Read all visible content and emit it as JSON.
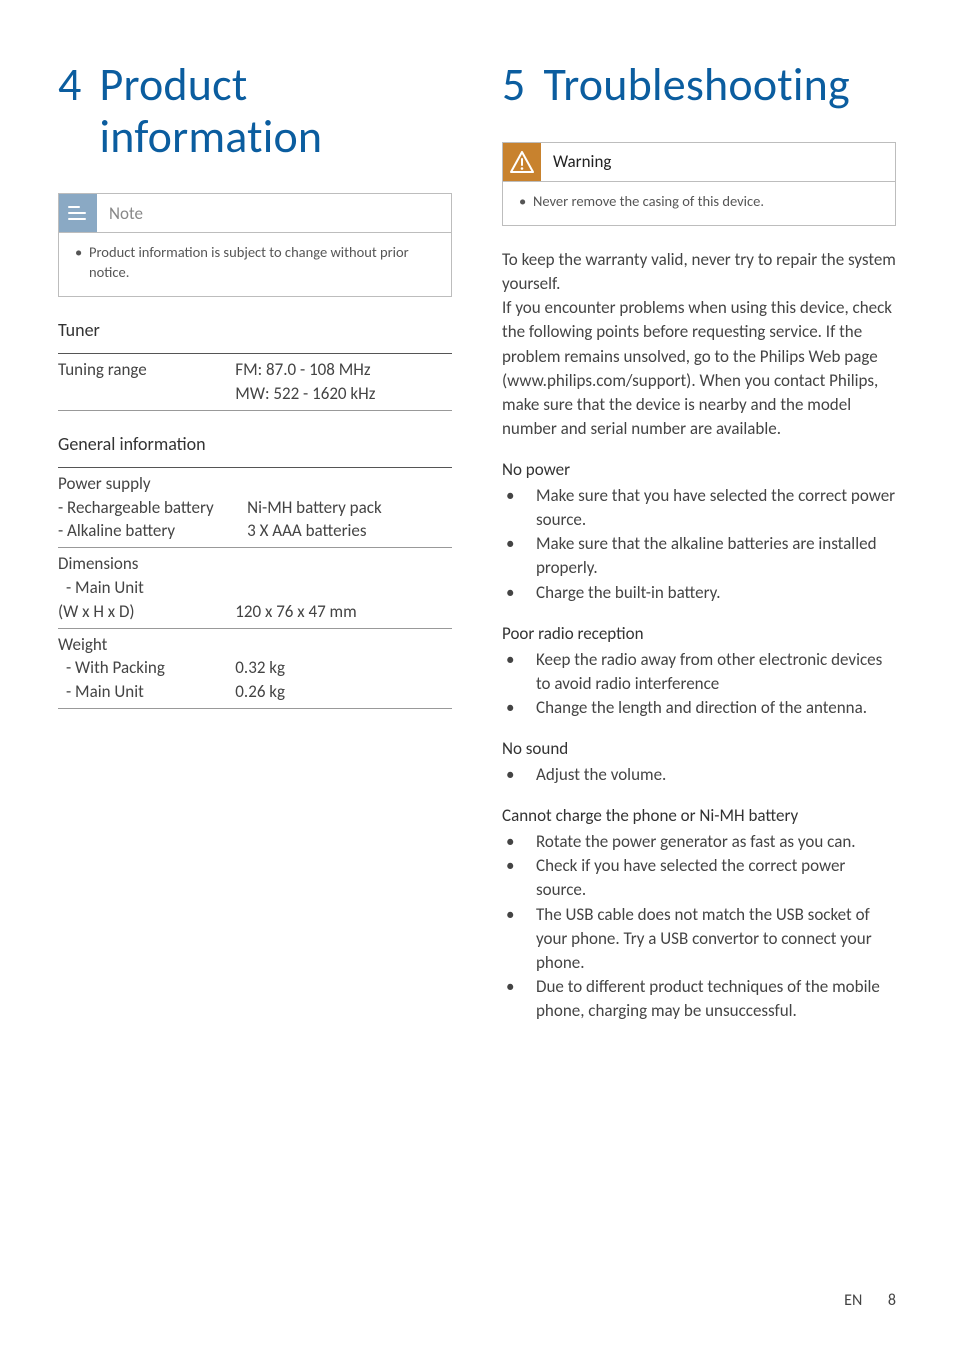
{
  "left": {
    "number": "4",
    "title": "Product information",
    "note_label": "Note",
    "note_text": "Product information is subject to change without prior notice.",
    "tuner_heading": "Tuner",
    "tuner": {
      "label": "Tuning range",
      "fm": "FM: 87.0 - 108 MHz",
      "mw": "MW: 522 - 1620 kHz"
    },
    "general_heading": "General information",
    "power": {
      "label": "Power supply",
      "r_label": " - Rechargeable battery",
      "r_value": "Ni-MH battery pack",
      "a_label": " - Alkaline battery",
      "a_value": "3 X AAA batteries"
    },
    "dim": {
      "label": "Dimensions",
      "sub_label": " - Main Unit",
      "sub_unit": "(W x H x D)",
      "value": "120 x 76 x 47 mm"
    },
    "weight": {
      "label": "Weight",
      "pack_label": " - With Packing",
      "pack_value": "0.32 kg",
      "main_label": " - Main Unit",
      "main_value": "0.26 kg"
    }
  },
  "right": {
    "number": "5",
    "title": "Troubleshooting",
    "warn_label": "Warning",
    "warn_text": "Never remove the casing of this device.",
    "intro": "To keep the warranty valid, never try to repair the system yourself.\nIf you encounter problems when using this device, check the following points before requesting service. If the problem remains unsolved, go to the Philips Web page (www.philips.com/support). When you contact Philips, make sure that the device is nearby and the model number and serial number are available.",
    "issues": [
      {
        "heading": "No power",
        "items": [
          "Make sure that you have selected the correct power source.",
          "Make sure that the alkaline batteries are installed properly.",
          "Charge the built-in battery."
        ]
      },
      {
        "heading": "Poor radio reception",
        "items": [
          " Keep the radio away from other electronic devices to avoid radio interference",
          "Change the length and direction of the antenna."
        ]
      },
      {
        "heading": "No sound",
        "items": [
          "Adjust the volume."
        ]
      },
      {
        "heading": "Cannot charge the phone or Ni-MH battery",
        "items": [
          "Rotate the power generator as fast as you can.",
          "Check if you have selected the correct power source.",
          "The USB cable does not match the USB socket of your phone. Try a USB convertor to connect your phone.",
          "Due to different product techniques of the mobile phone, charging may be unsuccessful."
        ]
      }
    ]
  },
  "chart_data": {
    "type": "table",
    "title": "Product information specifications",
    "rows": [
      {
        "section": "Tuner",
        "label": "Tuning range",
        "value": "FM: 87.0 - 108 MHz; MW: 522 - 1620 kHz"
      },
      {
        "section": "General information",
        "label": "Power supply - Rechargeable battery",
        "value": "Ni-MH battery pack"
      },
      {
        "section": "General information",
        "label": "Power supply - Alkaline battery",
        "value": "3 X AAA batteries"
      },
      {
        "section": "General information",
        "label": "Dimensions - Main Unit (W x H x D)",
        "value": "120 x 76 x 47 mm"
      },
      {
        "section": "General information",
        "label": "Weight - With Packing",
        "value": "0.32 kg"
      },
      {
        "section": "General information",
        "label": "Weight - Main Unit",
        "value": "0.26 kg"
      }
    ]
  },
  "footer": {
    "lang": "EN",
    "page": "8"
  }
}
